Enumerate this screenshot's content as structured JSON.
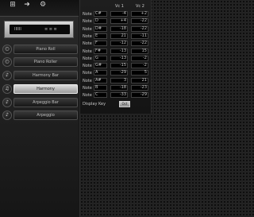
{
  "toolbar": {
    "buttons": [
      {
        "glyph": "⊞",
        "label": ""
      },
      {
        "glyph": "➜",
        "label": ""
      },
      {
        "glyph": "⚙",
        "label": ""
      }
    ]
  },
  "device": {
    "readout_left": "IIIIII",
    "readout_right": "≡ ≡ ≡"
  },
  "sidebar": {
    "items": [
      {
        "icon": "○",
        "label": "Piano Roll"
      },
      {
        "icon": "○",
        "label": "Piano Roller"
      },
      {
        "icon": "♪",
        "label": "Harmony Bar"
      },
      {
        "icon": "♫",
        "label": "Harmony"
      },
      {
        "icon": "♪",
        "label": "Arpeggio Bar"
      },
      {
        "icon": "♪",
        "label": "Arpeggio"
      }
    ],
    "active_index": 3
  },
  "table": {
    "col_voice1": "Vc 1",
    "col_voice2": "Vc 2",
    "rows": [
      {
        "name": "Note",
        "key": "C#",
        "v1": "-4",
        "v2": "+2"
      },
      {
        "name": "Note",
        "key": "D",
        "v1": "+4",
        "v2": "-22"
      },
      {
        "name": "Note",
        "key": "D#",
        "v1": "-18",
        "v2": "-22"
      },
      {
        "name": "Note",
        "key": "E",
        "v1": "21",
        "v2": "-11"
      },
      {
        "name": "Note",
        "key": "F",
        "v1": "-12",
        "v2": "-22"
      },
      {
        "name": "Note",
        "key": "F#",
        "v1": "-13",
        "v2": "15"
      },
      {
        "name": "Note",
        "key": "G",
        "v1": "-13",
        "v2": "-2"
      },
      {
        "name": "Note",
        "key": "G#",
        "v1": "-15",
        "v2": "-2"
      },
      {
        "name": "Note",
        "key": "A",
        "v1": "-29",
        "v2": "5"
      },
      {
        "name": "Note",
        "key": "A#",
        "v1": "3",
        "v2": "21"
      },
      {
        "name": "Note",
        "key": "B",
        "v1": "-18",
        "v2": "-23"
      },
      {
        "name": "Note",
        "key": "C",
        "v1": "-33",
        "v2": "-29"
      }
    ],
    "display_key_label": "Display Key",
    "display_key_value": "Oct"
  }
}
